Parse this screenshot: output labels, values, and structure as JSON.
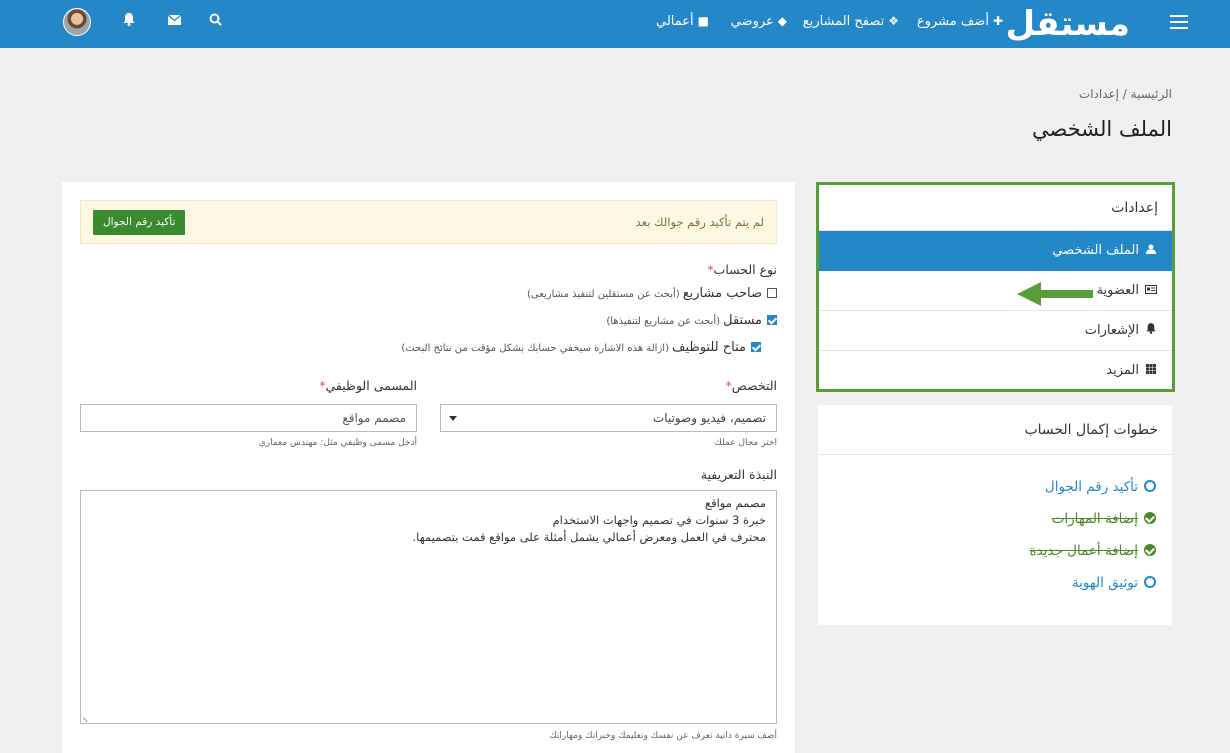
{
  "header": {
    "logo": "مستقل",
    "nav": {
      "add_project": "أضف مشروع",
      "browse_projects": "تصفح المشاريع",
      "my_offers": "عروضي",
      "my_works": "أعمالي"
    }
  },
  "breadcrumb": "الرئيسية / إعدادات",
  "page_title": "الملف الشخصي",
  "settings": {
    "title": "إعدادات",
    "items": [
      {
        "label": "الملف الشخصي",
        "icon": "user-icon"
      },
      {
        "label": "العضوية",
        "icon": "id-card-icon"
      },
      {
        "label": "الإشعارات",
        "icon": "bell-icon"
      },
      {
        "label": "المزيد",
        "icon": "grid-icon"
      }
    ]
  },
  "steps": {
    "title": "خطوات إكمال الحساب",
    "items": [
      {
        "label": "تأكيد رقم الجوال",
        "done": false
      },
      {
        "label": "إضافة المهارات",
        "done": true
      },
      {
        "label": "إضافة أعمال جديدة",
        "done": true
      },
      {
        "label": "توثيق الهوية",
        "done": false
      }
    ]
  },
  "form": {
    "alert_message": "لم يتم تأكيد رقم جوالك بعد",
    "confirm_phone_button": "تأكيد رقم الجوال",
    "account_type_label": "نوع الحساب",
    "options": {
      "owner": {
        "label": "صاحب مشاريع",
        "hint": "(أبحث عن مستقلين لتنفيذ مشاريعى)",
        "checked": false
      },
      "freelancer": {
        "label": "مستقل",
        "hint": "(أبحث عن مشاريع لتنفيذها)",
        "checked": true
      },
      "hiring": {
        "label": "متاح للتوظيف",
        "hint": "(ازالة هذه الاشارة سيخفي حسابك بشكل مؤقت من نتائج البحث)",
        "checked": true
      }
    },
    "specialty_label": "التخصص",
    "specialty_value": "تصميم، فيديو وصوتيات",
    "specialty_help": "اختر مجال عملك",
    "job_title_label": "المسمى الوظيفي",
    "job_title_value": "مصمم مواقع",
    "job_title_help": "أدخل مسمى وظيفي مثل: مهندس معماري",
    "bio_label": "النبذة التعريفية",
    "bio_lines": [
      "مصمم مواقع",
      "خبرة 3 سنوات في تصميم واجهات الاستخدام",
      "محترف في العمل ومعرض أعمالي يشمل أمثلة على مواقع قمت بتصميمها."
    ],
    "bio_help": "أضف سيرة ذاتية تعرف عن نفسك وتعليمك وخبراتك ومهاراتك"
  },
  "colors": {
    "primary": "#2387c8",
    "success": "#3a8a2e",
    "highlight_border": "#5a9e3a"
  }
}
